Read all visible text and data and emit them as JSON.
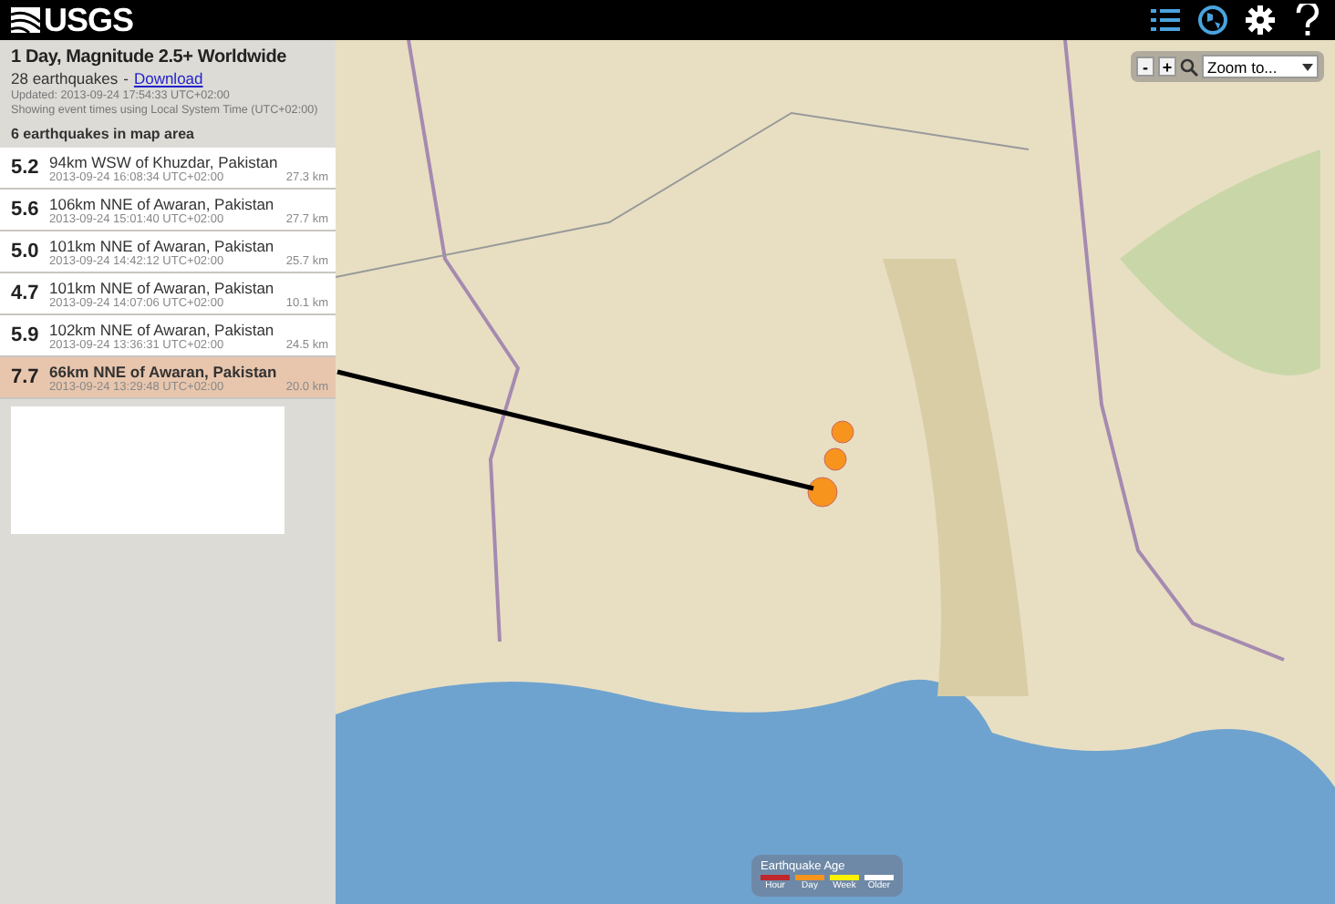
{
  "header": {
    "logo": "USGS"
  },
  "summary": {
    "title": "1 Day, Magnitude 2.5+ Worldwide",
    "count": "28 earthquakes",
    "separator": "-",
    "download": "Download",
    "updated": "Updated: 2013-09-24 17:54:33 UTC+02:00",
    "timezone": "Showing event times using Local System Time (UTC+02:00)",
    "map_count": "6 earthquakes in map area"
  },
  "earthquakes": [
    {
      "magnitude": "5.2",
      "place": "94km WSW of Khuzdar, Pakistan",
      "time": "2013-09-24 16:08:34 UTC+02:00",
      "depth": "27.3 km",
      "selected": false
    },
    {
      "magnitude": "5.6",
      "place": "106km NNE of Awaran, Pakistan",
      "time": "2013-09-24 15:01:40 UTC+02:00",
      "depth": "27.7 km",
      "selected": false
    },
    {
      "magnitude": "5.0",
      "place": "101km NNE of Awaran, Pakistan",
      "time": "2013-09-24 14:42:12 UTC+02:00",
      "depth": "25.7 km",
      "selected": false
    },
    {
      "magnitude": "4.7",
      "place": "101km NNE of Awaran, Pakistan",
      "time": "2013-09-24 14:07:06 UTC+02:00",
      "depth": "10.1 km",
      "selected": false
    },
    {
      "magnitude": "5.9",
      "place": "102km NNE of Awaran, Pakistan",
      "time": "2013-09-24 13:36:31 UTC+02:00",
      "depth": "24.5 km",
      "selected": false
    },
    {
      "magnitude": "7.7",
      "place": "66km NNE of Awaran, Pakistan",
      "time": "2013-09-24 13:29:48 UTC+02:00",
      "depth": "20.0 km",
      "selected": true
    }
  ],
  "map_controls": {
    "zoom_out": "-",
    "zoom_in": "+",
    "zoom_select": "Zoom to..."
  },
  "legend": {
    "title": "Earthquake Age",
    "items": [
      {
        "label": "Hour",
        "color": "#c0272d"
      },
      {
        "label": "Day",
        "color": "#f7941d"
      },
      {
        "label": "Week",
        "color": "#fff200"
      },
      {
        "label": "Older",
        "color": "#ffffff"
      }
    ]
  }
}
